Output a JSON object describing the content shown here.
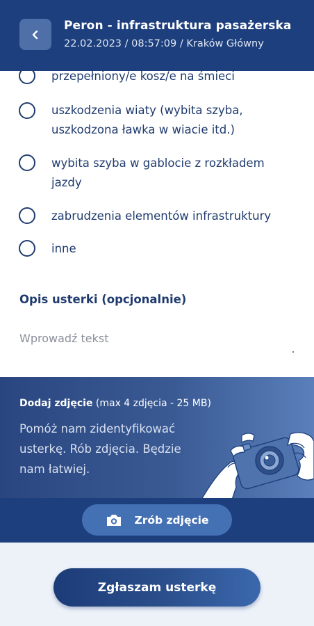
{
  "header": {
    "title": "Peron - infrastruktura pasażerska",
    "subtitle": "22.02.2023 / 08:57:09 / Kraków Główny",
    "back_icon": "chevron-left-icon"
  },
  "options": [
    {
      "label": "przepełniony/e kosz/e na śmieci",
      "selected": false
    },
    {
      "label": "uszkodzenia wiaty (wybita szyba, uszkodzona ławka w wiacie itd.)",
      "selected": false
    },
    {
      "label": "wybita szyba w gablocie z rozkładem jazdy",
      "selected": false
    },
    {
      "label": "zabrudzenia elementów infrastruktury",
      "selected": false
    },
    {
      "label": "inne",
      "selected": false
    }
  ],
  "description": {
    "label": "Opis usterki (opcjonalnie)",
    "placeholder": "Wprowadź tekst",
    "value": ""
  },
  "photo": {
    "title_bold": "Dodaj zdjęcie",
    "title_rest": " (max 4 zdjęcia - 25 MB)",
    "description": "Pomóż nam zidentyfikować usterkę. Rób zdjęcia. Będzie nam łatwiej.",
    "button_label": "Zrób zdjęcie",
    "button_icon": "camera-icon",
    "illustration": "hands-holding-camera-illustration"
  },
  "submit": {
    "label": "Zgłaszam usterkę"
  },
  "colors": {
    "primary": "#1d3f7d",
    "accent": "#4470b4",
    "text": "#1f3b6e",
    "background_light": "#edf2f9"
  }
}
